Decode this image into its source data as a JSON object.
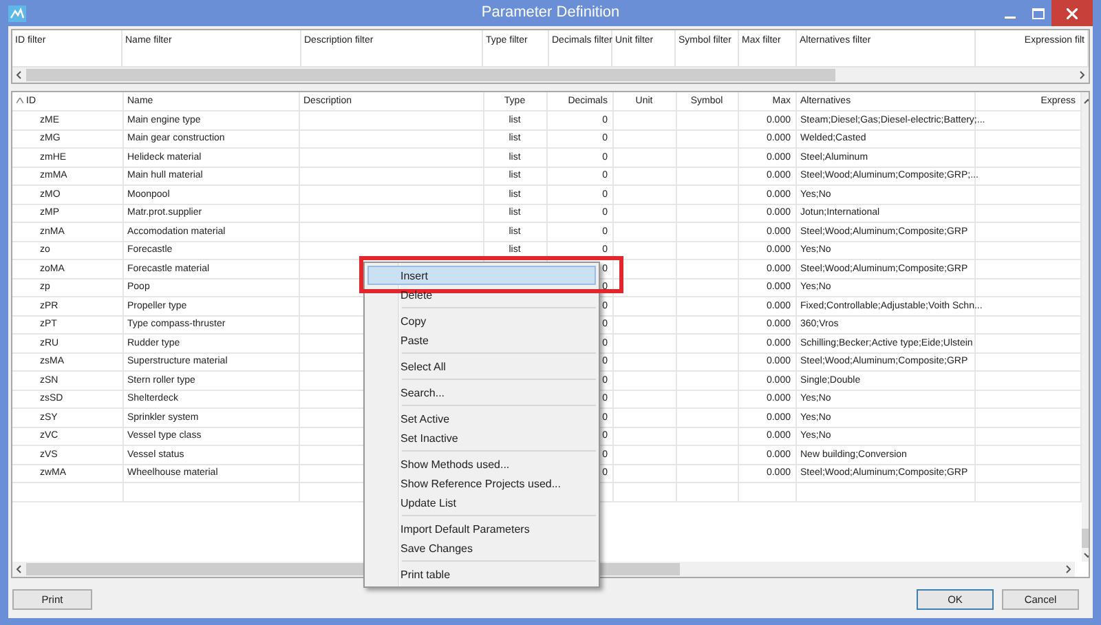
{
  "window": {
    "title": "Parameter Definition"
  },
  "filters": [
    "ID filter",
    "Name filter",
    "Description filter",
    "Type filter",
    "Decimals filter",
    "Unit filter",
    "Symbol filter",
    "Max filter",
    "Alternatives filter",
    "Expression filt"
  ],
  "table": {
    "columns": [
      {
        "label": "ID",
        "sorted": true
      },
      {
        "label": "Name",
        "sorted": false
      },
      {
        "label": "Description",
        "sorted": false
      },
      {
        "label": "Type",
        "sorted": false
      },
      {
        "label": "Decimals",
        "sorted": false
      },
      {
        "label": "Unit",
        "sorted": false
      },
      {
        "label": "Symbol",
        "sorted": false
      },
      {
        "label": "Max",
        "sorted": false
      },
      {
        "label": "Alternatives",
        "sorted": false
      },
      {
        "label": "Express",
        "sorted": false
      }
    ],
    "rows": [
      {
        "id": "zME",
        "name": "Main engine type",
        "type": "list",
        "decimals": "0",
        "max": "0.000",
        "alternatives": "Steam;Diesel;Gas;Diesel-electric;Battery;..."
      },
      {
        "id": "zMG",
        "name": "Main gear construction",
        "type": "list",
        "decimals": "0",
        "max": "0.000",
        "alternatives": "Welded;Casted"
      },
      {
        "id": "zmHE",
        "name": "Helideck material",
        "type": "list",
        "decimals": "0",
        "max": "0.000",
        "alternatives": "Steel;Aluminum"
      },
      {
        "id": "zmMA",
        "name": "Main hull material",
        "type": "list",
        "decimals": "0",
        "max": "0.000",
        "alternatives": "Steel;Wood;Aluminum;Composite;GRP;..."
      },
      {
        "id": "zMO",
        "name": "Moonpool",
        "type": "list",
        "decimals": "0",
        "max": "0.000",
        "alternatives": "Yes;No"
      },
      {
        "id": "zMP",
        "name": "Matr.prot.supplier",
        "type": "list",
        "decimals": "0",
        "max": "0.000",
        "alternatives": "Jotun;International"
      },
      {
        "id": "znMA",
        "name": "Accomodation material",
        "type": "list",
        "decimals": "0",
        "max": "0.000",
        "alternatives": "Steel;Wood;Aluminum;Composite;GRP"
      },
      {
        "id": "zo",
        "name": "Forecastle",
        "type": "list",
        "decimals": "0",
        "max": "0.000",
        "alternatives": "Yes;No"
      },
      {
        "id": "zoMA",
        "name": "Forecastle material",
        "decimals": "0",
        "max": "0.000",
        "alternatives": "Steel;Wood;Aluminum;Composite;GRP"
      },
      {
        "id": "zp",
        "name": "Poop",
        "decimals": "0",
        "max": "0.000",
        "alternatives": "Yes;No"
      },
      {
        "id": "zPR",
        "name": "Propeller type",
        "decimals": "0",
        "max": "0.000",
        "alternatives": "Fixed;Controllable;Adjustable;Voith Schn..."
      },
      {
        "id": "zPT",
        "name": "Type compass-thruster",
        "decimals": "0",
        "max": "0.000",
        "alternatives": "360;Vros"
      },
      {
        "id": "zRU",
        "name": "Rudder type",
        "decimals": "0",
        "max": "0.000",
        "alternatives": "Schilling;Becker;Active type;Eide;Ulstein"
      },
      {
        "id": "zsMA",
        "name": "Superstructure material",
        "decimals": "0",
        "max": "0.000",
        "alternatives": "Steel;Wood;Aluminum;Composite;GRP"
      },
      {
        "id": "zSN",
        "name": "Stern roller type",
        "decimals": "0",
        "max": "0.000",
        "alternatives": "Single;Double"
      },
      {
        "id": "zsSD",
        "name": "Shelterdeck",
        "decimals": "0",
        "max": "0.000",
        "alternatives": "Yes;No"
      },
      {
        "id": "zSY",
        "name": "Sprinkler system",
        "decimals": "0",
        "max": "0.000",
        "alternatives": "Yes;No"
      },
      {
        "id": "zVC",
        "name": "Vessel type class",
        "decimals": "0",
        "max": "0.000",
        "alternatives": "Yes;No"
      },
      {
        "id": "zVS",
        "name": "Vessel status",
        "decimals": "0",
        "max": "0.000",
        "alternatives": "New building;Conversion"
      },
      {
        "id": "zwMA",
        "name": "Wheelhouse material",
        "decimals": "0",
        "max": "0.000",
        "alternatives": "Steel;Wood;Aluminum;Composite;GRP"
      }
    ]
  },
  "context_menu": {
    "groups": [
      [
        {
          "label": "Insert",
          "selected": true,
          "outlined": true
        },
        {
          "label": "Delete",
          "selected": false,
          "outlined": false
        }
      ],
      [
        {
          "label": "Copy",
          "selected": false,
          "outlined": false
        },
        {
          "label": "Paste",
          "selected": false,
          "outlined": false
        }
      ],
      [
        {
          "label": "Select All",
          "selected": false,
          "outlined": false
        }
      ],
      [
        {
          "label": "Search...",
          "selected": false,
          "outlined": false
        }
      ],
      [
        {
          "label": "Set Active",
          "selected": false,
          "outlined": false
        },
        {
          "label": "Set Inactive",
          "selected": false,
          "outlined": false
        }
      ],
      [
        {
          "label": "Show Methods used...",
          "selected": false,
          "outlined": false
        },
        {
          "label": "Show Reference Projects used...",
          "selected": false,
          "outlined": false
        },
        {
          "label": "Update List",
          "selected": false,
          "outlined": false
        }
      ],
      [
        {
          "label": "Import Default Parameters",
          "selected": false,
          "outlined": false
        },
        {
          "label": "Save Changes",
          "selected": false,
          "outlined": false
        }
      ],
      [
        {
          "label": "Print table",
          "selected": false,
          "outlined": false
        }
      ]
    ]
  },
  "buttons": [
    {
      "label": "Print",
      "default": false
    },
    {
      "label": "OK",
      "default": true
    },
    {
      "label": "Cancel",
      "default": false
    }
  ]
}
